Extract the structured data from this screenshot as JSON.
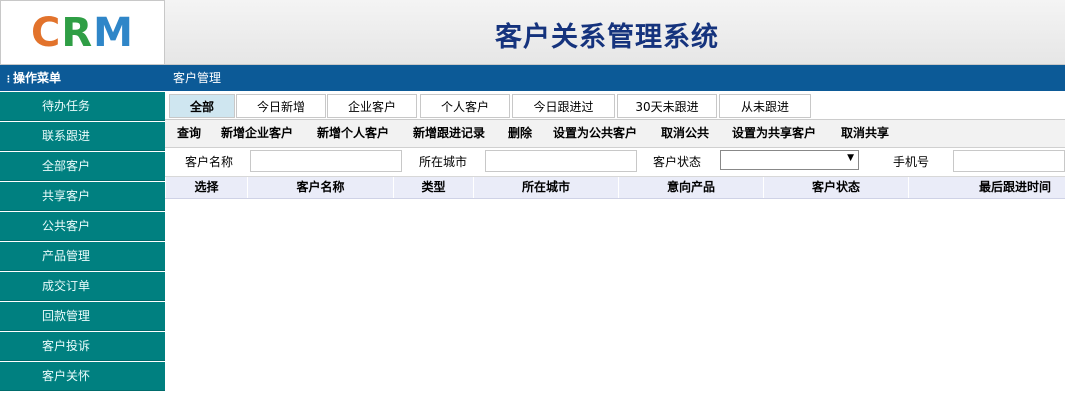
{
  "header": {
    "logo_c": "C",
    "logo_r": "R",
    "logo_m": "M",
    "title": "客户关系管理系统"
  },
  "sidebar": {
    "title": "操作菜单",
    "items": [
      {
        "label": "待办任务"
      },
      {
        "label": "联系跟进"
      },
      {
        "label": "全部客户"
      },
      {
        "label": "共享客户"
      },
      {
        "label": "公共客户"
      },
      {
        "label": "产品管理"
      },
      {
        "label": "成交订单"
      },
      {
        "label": "回款管理"
      },
      {
        "label": "客户投诉"
      },
      {
        "label": "客户关怀"
      }
    ]
  },
  "main": {
    "breadcrumb": "客户管理",
    "tabs": [
      {
        "label": "全部",
        "active": true
      },
      {
        "label": "今日新增"
      },
      {
        "label": "企业客户"
      },
      {
        "label": "个人客户"
      },
      {
        "label": "今日跟进过"
      },
      {
        "label": "30天未跟进"
      },
      {
        "label": "从未跟进"
      }
    ],
    "actions": [
      {
        "label": "查询"
      },
      {
        "label": "新增企业客户"
      },
      {
        "label": "新增个人客户"
      },
      {
        "label": "新增跟进记录"
      },
      {
        "label": "删除"
      },
      {
        "label": "设置为公共客户"
      },
      {
        "label": "取消公共"
      },
      {
        "label": "设置为共享客户"
      },
      {
        "label": "取消共享"
      }
    ],
    "filters": {
      "customer_name_label": "客户名称",
      "customer_name_value": "",
      "city_label": "所在城市",
      "city_value": "",
      "status_label": "客户状态",
      "status_value": "",
      "phone_label": "手机号",
      "phone_value": ""
    },
    "table_headers": [
      "选择",
      "客户名称",
      "类型",
      "所在城市",
      "意向产品",
      "客户状态",
      "最后跟进时间"
    ]
  },
  "colors": {
    "header_blue": "#0c5a97",
    "menu_teal": "#008080",
    "title_navy": "#15337d"
  }
}
